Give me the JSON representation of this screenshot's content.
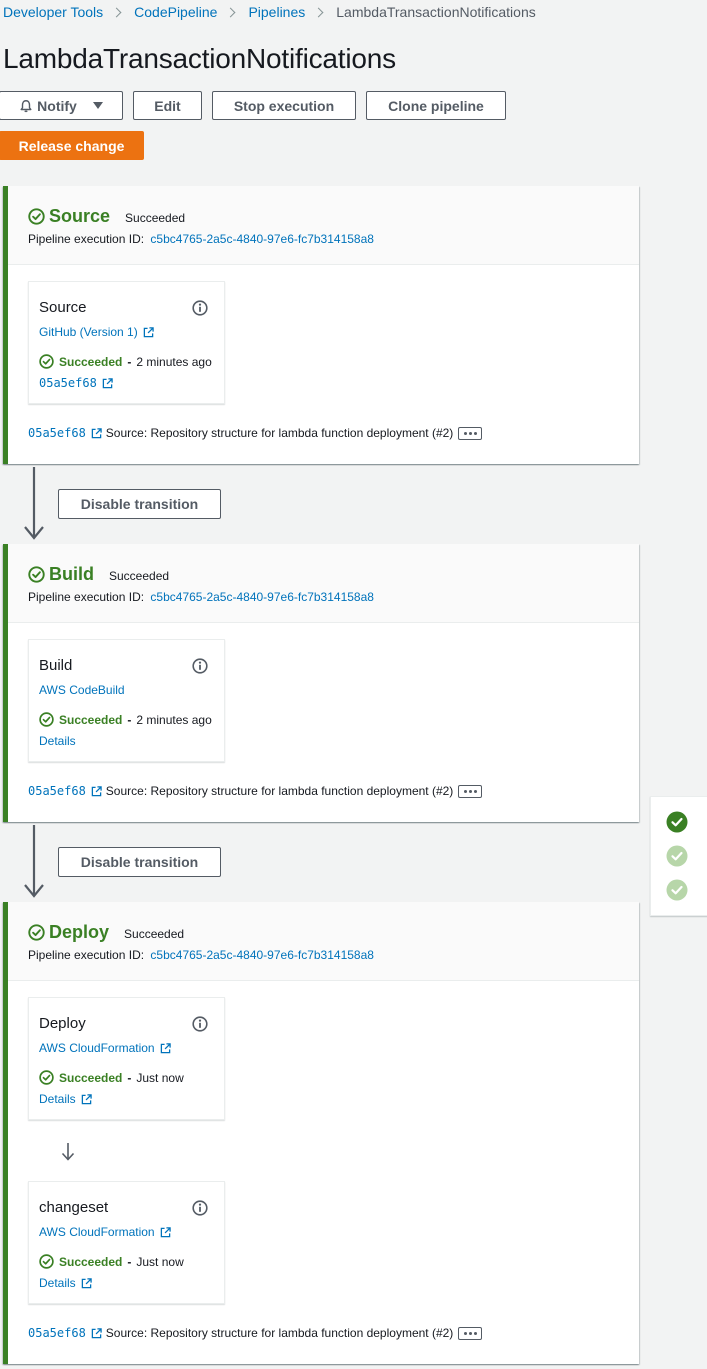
{
  "breadcrumb": [
    {
      "label": "Developer Tools"
    },
    {
      "label": "CodePipeline"
    },
    {
      "label": "Pipelines"
    },
    {
      "label": "LambdaTransactionNotifications"
    }
  ],
  "page_title": "LambdaTransactionNotifications",
  "toolbar": {
    "notify_label": "Notify",
    "edit_label": "Edit",
    "stop_label": "Stop execution",
    "clone_label": "Clone pipeline",
    "release_label": "Release change"
  },
  "colors": {
    "success": "#3a8024",
    "link": "#0073bb",
    "primary": "#ec7211"
  },
  "transition_label": "Disable transition",
  "stages": [
    {
      "name": "Source",
      "status": "Succeeded",
      "exec_label": "Pipeline execution ID:",
      "exec_id": "c5bc4765-2a5c-4840-97e6-fc7b314158a8",
      "actions": [
        {
          "name": "Source",
          "provider": "GitHub (Version 1)",
          "status": "Succeeded",
          "time": "2 minutes ago",
          "details": "05a5ef68"
        }
      ],
      "commit": {
        "id": "05a5ef68",
        "message": "Source: Repository structure for lambda function deployment (#2)"
      }
    },
    {
      "name": "Build",
      "status": "Succeeded",
      "exec_label": "Pipeline execution ID:",
      "exec_id": "c5bc4765-2a5c-4840-97e6-fc7b314158a8",
      "actions": [
        {
          "name": "Build",
          "provider": "AWS CodeBuild",
          "status": "Succeeded",
          "time": "2 minutes ago",
          "details": "Details"
        }
      ],
      "commit": {
        "id": "05a5ef68",
        "message": "Source: Repository structure for lambda function deployment (#2)"
      }
    },
    {
      "name": "Deploy",
      "status": "Succeeded",
      "exec_label": "Pipeline execution ID:",
      "exec_id": "c5bc4765-2a5c-4840-97e6-fc7b314158a8",
      "actions": [
        {
          "name": "Deploy",
          "provider": "AWS CloudFormation",
          "status": "Succeeded",
          "time": "Just now",
          "details": "Details"
        },
        {
          "name": "changeset",
          "provider": "AWS CloudFormation",
          "status": "Succeeded",
          "time": "Just now",
          "details": "Details"
        }
      ],
      "commit": {
        "id": "05a5ef68",
        "message": "Source: Repository structure for lambda function deployment (#2)"
      }
    }
  ],
  "side_panel": {
    "icons": [
      "check-circle-filled-icon",
      "check-circle-light-icon",
      "check-circle-light-icon"
    ]
  }
}
